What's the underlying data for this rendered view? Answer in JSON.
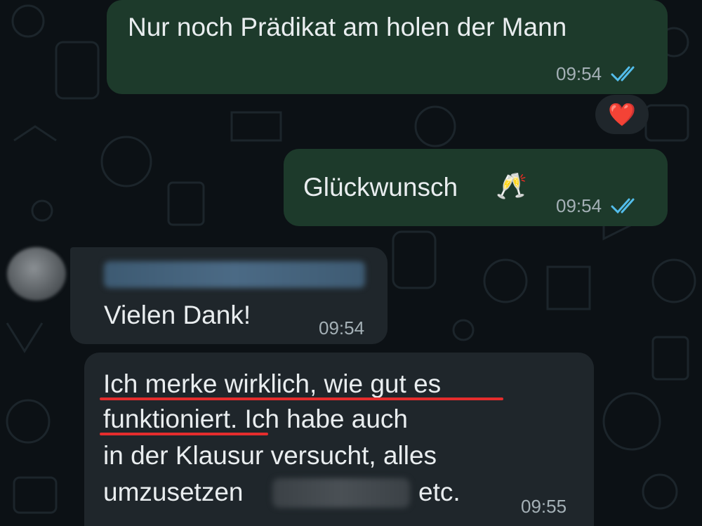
{
  "messages": [
    {
      "direction": "outgoing",
      "text": "Nur noch Prädikat am holen der Mann",
      "time": "09:54",
      "status": "read",
      "reaction": "❤️"
    },
    {
      "direction": "outgoing",
      "text": "Glückwunsch",
      "emoji": "🥂",
      "time": "09:54",
      "status": "read"
    },
    {
      "direction": "incoming",
      "text": "Vielen Dank!",
      "time": "09:54"
    },
    {
      "direction": "incoming",
      "lines": [
        "Ich merke wirklich, wie gut es",
        "funktioniert. Ich habe auch",
        "in der Klausur versucht, alles",
        "umzusetzen",
        "etc."
      ],
      "time": "09:55"
    }
  ],
  "icons": {
    "read_ticks": "double-check-icon",
    "reaction": "heart-icon",
    "toast": "champagne-glasses-icon"
  },
  "colors": {
    "background": "#0c1115",
    "outgoing_bubble": "#1d3a2b",
    "incoming_bubble": "#1f262b",
    "text": "#e9edef",
    "time": "#a4b0b6",
    "read_ticks": "#53bdeb",
    "highlight": "#e52d2d"
  }
}
